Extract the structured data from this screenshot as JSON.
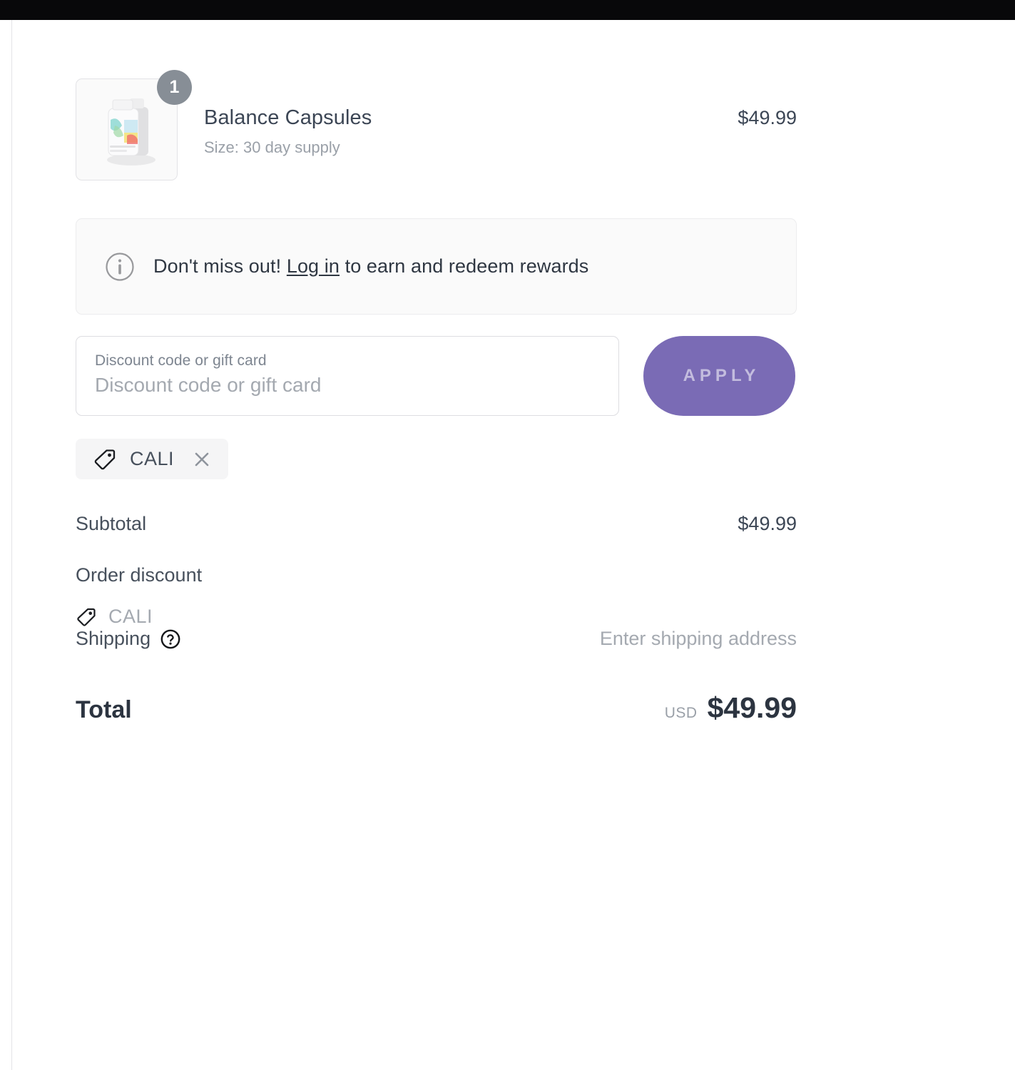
{
  "theme": {
    "accent": "#7a6bb5",
    "top_bar": "#08080a",
    "text_dark": "#3c4655",
    "text_muted": "#9aa0a8",
    "panel_bg": "#fafafa"
  },
  "line_item": {
    "quantity_badge": "1",
    "title": "Balance Capsules",
    "variant": "Size: 30 day supply",
    "price": "$49.99",
    "image_alt": "supplement-bottle"
  },
  "rewards_banner": {
    "icon": "info-circle-icon",
    "text_before": "Don't miss out! ",
    "link_label": "Log in",
    "text_after": " to earn and redeem rewards"
  },
  "discount": {
    "field_label": "Discount code or gift card",
    "field_placeholder": "Discount code or gift card",
    "field_value": "",
    "apply_label": "APPLY",
    "applied": [
      {
        "code": "CALI",
        "icon": "tag-icon",
        "remove_icon": "close-icon"
      }
    ]
  },
  "summary": {
    "subtotal": {
      "label": "Subtotal",
      "value": "$49.99"
    },
    "order_discount": {
      "label": "Order discount",
      "code": "CALI",
      "value": ""
    },
    "shipping": {
      "label": "Shipping",
      "help_icon": "question-circle-icon",
      "value": "Enter shipping address"
    },
    "total": {
      "label": "Total",
      "currency": "USD",
      "amount": "$49.99"
    }
  }
}
